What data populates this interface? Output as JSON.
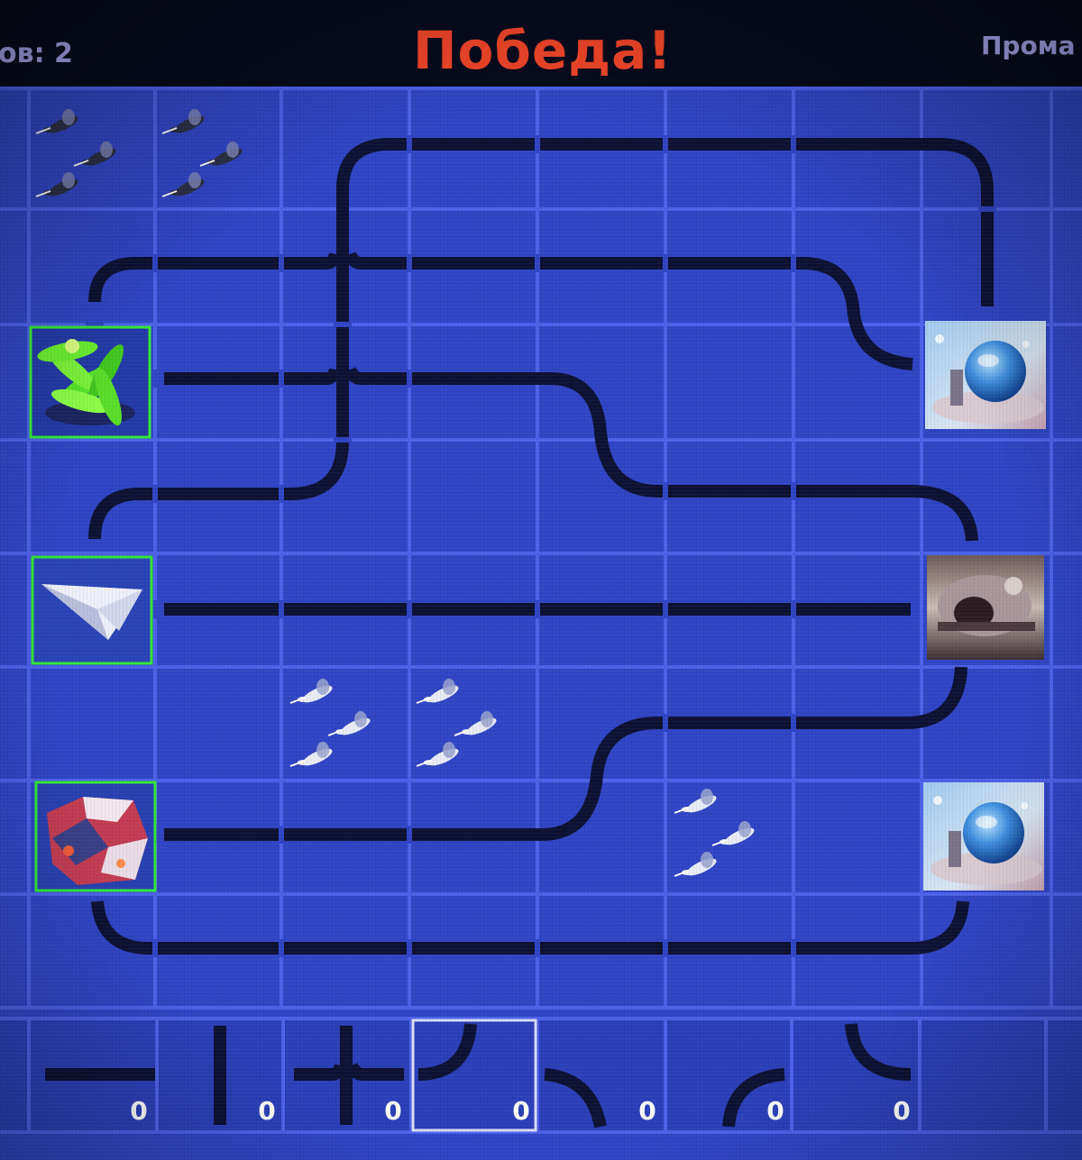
{
  "header": {
    "moves_text": "ов: 2",
    "status_text": "Победа!",
    "skip_text": "Прома"
  },
  "colors": {
    "background": "#2f45c4",
    "grid_line": "#4c61e8",
    "pipe": "#0d1133",
    "status": "#f0462a",
    "selected_frame": "#35e83a"
  },
  "board": {
    "rows": 8,
    "cols": 9,
    "cells": [
      [
        "",
        "bees",
        "bees",
        "",
        "",
        "",
        "",
        "",
        ""
      ],
      [
        "",
        "",
        "",
        "",
        "",
        "",
        "",
        "",
        ""
      ],
      [
        "",
        "green-plant",
        "",
        "",
        "",
        "",
        "",
        "",
        "globe-base"
      ],
      [
        "",
        "",
        "",
        "",
        "",
        "",
        "",
        "",
        ""
      ],
      [
        "",
        "paper-plane",
        "",
        "",
        "",
        "",
        "",
        "",
        "rocky-cave"
      ],
      [
        "",
        "",
        "",
        "bees",
        "bees",
        "",
        "",
        "",
        ""
      ],
      [
        "",
        "red-crystal",
        "",
        "",
        "",
        "",
        "bees",
        "",
        "globe-base"
      ],
      [
        "",
        "",
        "",
        "",
        "",
        "",
        "",
        "",
        ""
      ]
    ],
    "selected_sources": [
      "green-plant",
      "paper-plane",
      "red-crystal"
    ]
  },
  "toolbar": {
    "pieces": [
      {
        "icon": "horizontal-pipe",
        "count": "0"
      },
      {
        "icon": "vertical-pipe",
        "count": "0"
      },
      {
        "icon": "cross-pipe",
        "count": "0"
      },
      {
        "icon": "corner-pipe-up-left",
        "count": "0",
        "selected": true
      },
      {
        "icon": "corner-pipe-down-left",
        "count": "0"
      },
      {
        "icon": "corner-pipe-down-right",
        "count": "0"
      },
      {
        "icon": "corner-pipe-up-right",
        "count": "0"
      }
    ]
  }
}
